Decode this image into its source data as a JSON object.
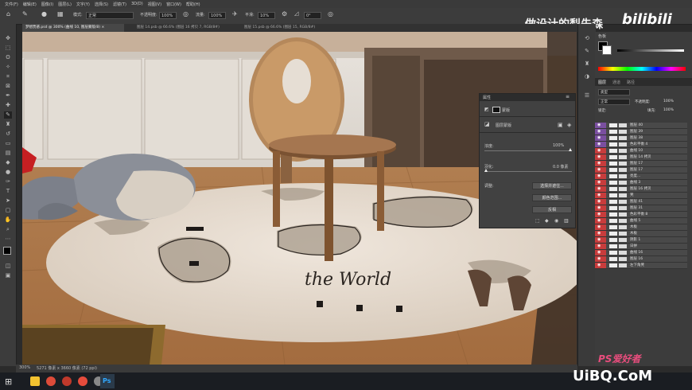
{
  "menu": [
    "文件(F)",
    "编辑(E)",
    "图像(I)",
    "图层(L)",
    "文字(Y)",
    "选择(S)",
    "滤镜(T)",
    "3D(D)",
    "视图(V)",
    "窗口(W)",
    "帮助(H)"
  ],
  "options": {
    "mode_label": "模式:",
    "mode_value": "正常",
    "opacity_label": "不透明度:",
    "opacity_value": "100%",
    "flow_label": "流量:",
    "flow_value": "100%",
    "smooth_label": "平滑:",
    "smooth_value": "10%",
    "angle_value": "0°"
  },
  "watermark": {
    "channel": "做设计的梨先森",
    "brand": "bilibili",
    "site": "UiBQ.CoM",
    "site_cn": "PS爱好者"
  },
  "tabs": [
    {
      "label": "梦想贾惑.psd @ 300% (曲线 10, 图层蒙版/8) ×",
      "active": true
    },
    {
      "label": "图层 14.psb @ 66.6% (图层 16 拷贝 7, RGB/8#)",
      "active": false
    },
    {
      "label": "图层 15.psb @ 66.6% (图层 15, RGB/8#)",
      "active": false
    }
  ],
  "status": {
    "zoom": "300%",
    "doc": "5271 像素 x 3660 像素 (72 ppi)"
  },
  "properties": {
    "tab": "属性",
    "mask_title": "蒙版",
    "layer_mask": "图层蒙版",
    "density_label": "浓度:",
    "density_value": "100%",
    "feather_label": "羽化:",
    "feather_value": "0.0 像素",
    "density_fraction": 1.0,
    "feather_fraction": 0.0,
    "adjust_label": "调整:",
    "btn_select_mask": "选择并遮住...",
    "btn_color_range": "颜色范围...",
    "btn_invert": "反相"
  },
  "swatches_title": "色板",
  "layers_panel": {
    "tabs": [
      "图层",
      "通道",
      "路径"
    ],
    "kind": "类型",
    "blend": "正常",
    "opacity_label": "不透明度:",
    "opacity_value": "100%",
    "lock_label": "锁定:",
    "fill_label": "填充:",
    "fill_value": "100%",
    "layers": [
      {
        "name": "图层 40",
        "color": "#7a4fa0"
      },
      {
        "name": "图层 39",
        "color": "#7a4fa0"
      },
      {
        "name": "图层 38",
        "color": "#7a4fa0"
      },
      {
        "name": "色彩平衡 4",
        "color": "#7a4fa0"
      },
      {
        "name": "曲线 10",
        "color": "#c83c3c"
      },
      {
        "name": "图层 14 拷贝",
        "color": "#c83c3c"
      },
      {
        "name": "图层 17",
        "color": "#c83c3c"
      },
      {
        "name": "图层 17",
        "color": "#c83c3c"
      },
      {
        "name": "亮度...",
        "color": "#c83c3c"
      },
      {
        "name": "曲线 3",
        "color": "#c83c3c"
      },
      {
        "name": "图层 16 拷贝",
        "color": "#c83c3c"
      },
      {
        "name": "凳",
        "color": "#c83c3c"
      },
      {
        "name": "图层 41",
        "color": "#c83c3c"
      },
      {
        "name": "图层 31",
        "color": "#c83c3c"
      },
      {
        "name": "色彩平衡 8",
        "color": "#c83c3c"
      },
      {
        "name": "曲线 5",
        "color": "#c83c3c"
      },
      {
        "name": "木板",
        "color": "#c83c3c"
      },
      {
        "name": "木板",
        "color": "#c83c3c"
      },
      {
        "name": "阴影 1",
        "color": "#c83c3c"
      },
      {
        "name": "日拼",
        "color": "#c83c3c"
      },
      {
        "name": "曲线 16",
        "color": "#c83c3c"
      },
      {
        "name": "图层 16",
        "color": "#c83c3c"
      },
      {
        "name": "左下角凳",
        "color": "#c83c3c"
      }
    ]
  },
  "rug_text": "the World"
}
